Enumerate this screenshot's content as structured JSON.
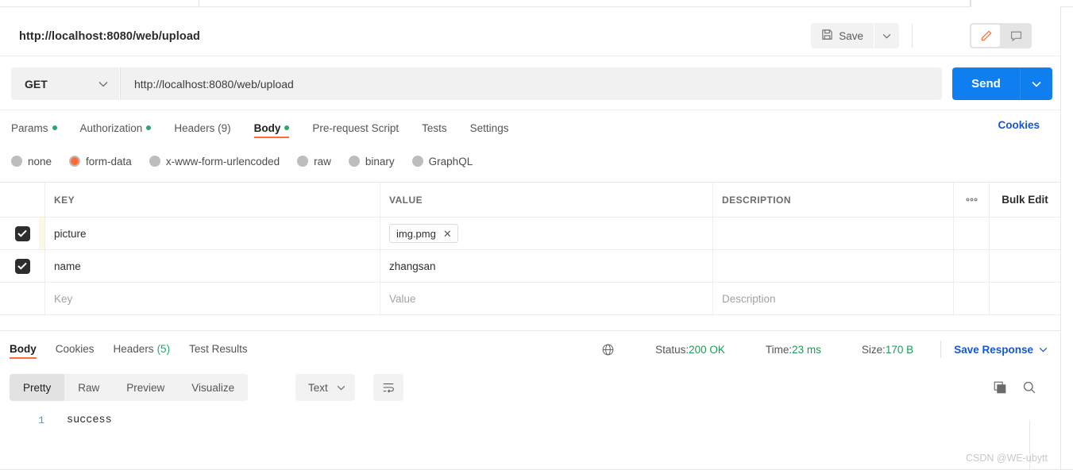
{
  "request": {
    "title": "http://localhost:8080/web/upload",
    "method": "GET",
    "url": "http://localhost:8080/web/upload",
    "send_label": "Send",
    "save_label": "Save",
    "cookies_link": "Cookies",
    "tabs": [
      {
        "label": "Params",
        "dot": true,
        "active": false
      },
      {
        "label": "Authorization",
        "dot": true,
        "active": false
      },
      {
        "label": "Headers (9)",
        "dot": false,
        "active": false
      },
      {
        "label": "Body",
        "dot": true,
        "active": true
      },
      {
        "label": "Pre-request Script",
        "dot": false,
        "active": false
      },
      {
        "label": "Tests",
        "dot": false,
        "active": false
      },
      {
        "label": "Settings",
        "dot": false,
        "active": false
      }
    ],
    "body_types": [
      {
        "label": "none",
        "selected": false
      },
      {
        "label": "form-data",
        "selected": true
      },
      {
        "label": "x-www-form-urlencoded",
        "selected": false
      },
      {
        "label": "raw",
        "selected": false
      },
      {
        "label": "binary",
        "selected": false
      },
      {
        "label": "GraphQL",
        "selected": false
      }
    ],
    "table": {
      "headers": {
        "key": "KEY",
        "value": "VALUE",
        "description": "DESCRIPTION",
        "bulk_edit": "Bulk Edit"
      },
      "rows": [
        {
          "checked": true,
          "key": "picture",
          "value": "img.pmg",
          "is_file": true,
          "description": "",
          "highlight": true
        },
        {
          "checked": true,
          "key": "name",
          "value": "zhangsan",
          "is_file": false,
          "description": "",
          "highlight": false
        }
      ],
      "placeholder_row": {
        "key": "Key",
        "value": "Value",
        "description": "Description"
      }
    }
  },
  "response": {
    "tabs": [
      {
        "label": "Body",
        "count": "",
        "active": true
      },
      {
        "label": "Cookies",
        "count": "",
        "active": false
      },
      {
        "label": "Headers",
        "count": "(5)",
        "active": false
      },
      {
        "label": "Test Results",
        "count": "",
        "active": false
      }
    ],
    "status_label": "Status:",
    "status_value": "200 OK",
    "time_label": "Time:",
    "time_value": "23 ms",
    "size_label": "Size:",
    "size_value": "170 B",
    "save_response": "Save Response",
    "view_modes": [
      {
        "label": "Pretty",
        "active": true
      },
      {
        "label": "Raw",
        "active": false
      },
      {
        "label": "Preview",
        "active": false
      },
      {
        "label": "Visualize",
        "active": false
      }
    ],
    "format": "Text",
    "line_number": "1",
    "body_text": "success"
  },
  "watermark": "CSDN @WE-ubytt",
  "colors": {
    "accent_orange": "#ff6c37",
    "link_blue": "#1356d8",
    "send_blue": "#0f7ff0",
    "status_green": "#1a9c55",
    "dot_green": "#26a96c"
  }
}
